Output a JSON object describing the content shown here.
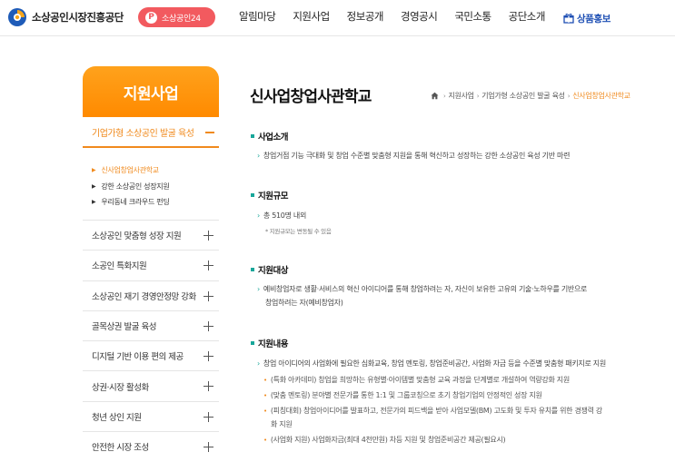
{
  "header": {
    "org_name": "소상공인시장진흥공단",
    "pill_label": "소상공인24",
    "pill_icon": "p-circle-icon",
    "nav": [
      "알림마당",
      "지원사업",
      "정보공개",
      "경영공시",
      "국민소통",
      "공단소개"
    ],
    "promo_label": "상품홍보",
    "promo_icon": "gift-icon"
  },
  "sidebar": {
    "title": "지원사업",
    "active_group": "기업가형 소상공인 발굴 육성",
    "sub_items": [
      {
        "label": "신사업창업사관학교",
        "active": true
      },
      {
        "label": "강한 소상공인 성장지원",
        "active": false
      },
      {
        "label": "우리동네 크라우드 펀딩",
        "active": false
      }
    ],
    "menu": [
      "소상공인 맞춤형 성장 지원",
      "소공인 특화지원",
      "소상공인 재기 경영안정망 강화",
      "골목상권 발굴 육성",
      "디지털 기반 이용 편의 제공",
      "상권·시장 활성화",
      "청년 상인 지원",
      "안전한 시장 조성"
    ]
  },
  "main": {
    "title": "신사업창업사관학교",
    "breadcrumb": [
      "지원사업",
      "기업가형 소상공인 발굴 육성",
      "신사업창업사관학교"
    ],
    "sections": {
      "intro": {
        "heading": "사업소개",
        "text": "창업거점 기능 극대화 및 창업 수준별 맞춤형 지원을 통해 혁신하고 성장하는 강한 소상공인 육성 기반 마련"
      },
      "scale": {
        "heading": "지원규모",
        "text": "총 510명 내외",
        "note": "* 지원규모는 변동될 수 있음"
      },
      "target": {
        "heading": "지원대상",
        "text1": "예비창업자로 생활·서비스의 혁신 아이디어를 통해 창업하려는 자, 자신이 보유한 고유의 기술·노하우를 기반으로",
        "text2": "창업하려는 자(예비창업자)"
      },
      "content": {
        "heading": "지원내용",
        "text": "창업 아이디어의 사업화에 필요한 심화교육, 창업 멘토링, 창업준비공간, 사업화 자금 등을 수준별 맞춤형 패키지로 지원",
        "items": [
          "(특화 아카데미) 창업을 희망하는 유형별·아이템별 맞춤형 교육 과정을 단계별로 개설하여 역량강화 지원",
          "(맞춤 멘토링) 분야별 전문가를 통한 1:1 및 그룹코칭으로 초기 창업기업의 안정적인 성장 지원",
          "(피칭대회) 창업아이디어를 발표하고, 전문가의 피드백을 받아 사업모델(BM) 고도화 및 투자 유치를 위한 경쟁력 강",
          "화 지원",
          "(사업화 지원) 사업화자금(최대 4천만원) 차등 지원 및 창업준비공간 제공(필요시)"
        ]
      }
    }
  },
  "colors": {
    "accent_orange": "#f08a1d",
    "pill_red": "#f25a5f",
    "teal": "#19a79a",
    "promo_blue": "#1e4fb4"
  }
}
